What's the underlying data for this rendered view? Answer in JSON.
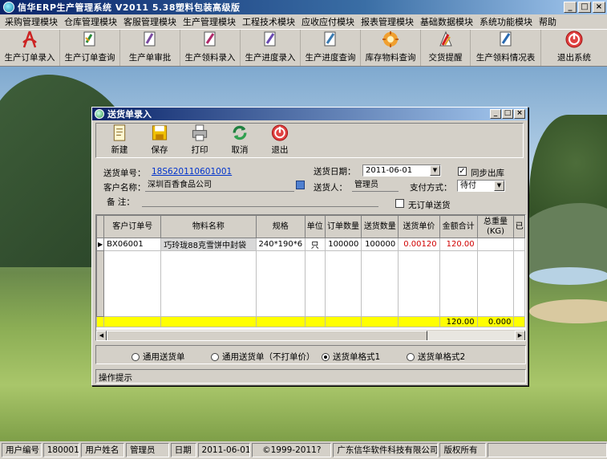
{
  "app": {
    "title": "信华ERP生产管理系统  V2011  5.38塑料包装高级版",
    "win_buttons": [
      "_",
      "□",
      "×"
    ]
  },
  "menu": [
    "采购管理模块",
    "仓库管理模块",
    "客服管理模块",
    "生产管理模块",
    "工程技术模块",
    "应收应付模块",
    "报表管理模块",
    "基础数据模块",
    "系统功能模块",
    "帮助"
  ],
  "toolbar": [
    {
      "label": "生产订单录入",
      "icon": "pdf-order-entry-icon",
      "color": "#cc2222"
    },
    {
      "label": "生产订单查询",
      "icon": "order-query-icon",
      "color": "#2a8a3a"
    },
    {
      "label": "生产单审批",
      "icon": "approval-icon",
      "color": "#7a4aa0"
    },
    {
      "label": "生产领料录入",
      "icon": "material-entry-icon",
      "color": "#b02a6a"
    },
    {
      "label": "生产进度录入",
      "icon": "progress-entry-icon",
      "color": "#6a4ab0"
    },
    {
      "label": "生产进度查询",
      "icon": "progress-query-icon",
      "color": "#3a7ab0"
    },
    {
      "label": "库存物料查询",
      "icon": "inventory-icon",
      "color": "#e08020"
    },
    {
      "label": "交货提醒",
      "icon": "delivery-alert-icon",
      "color": "#d02020"
    },
    {
      "label": "生产领料情况表",
      "icon": "material-report-icon",
      "color": "#2a6ab0"
    },
    {
      "label": "退出系统",
      "icon": "exit-icon",
      "color": "#d03030"
    }
  ],
  "child": {
    "title": "送货单录入",
    "toolbar": [
      {
        "label": "新建",
        "icon": "new-doc-icon"
      },
      {
        "label": "保存",
        "icon": "save-disk-icon"
      },
      {
        "label": "打印",
        "icon": "printer-icon"
      },
      {
        "label": "取消",
        "icon": "undo-arrows-icon"
      },
      {
        "label": "退出",
        "icon": "exit-icon"
      }
    ],
    "form": {
      "order_no_label": "送货单号：",
      "order_no": "18S620110601001",
      "date_label": "送货日期：",
      "date": "2011-06-01",
      "sync_label": "同步出库",
      "sync_checked": true,
      "customer_label": "客户名称：",
      "customer": "深圳百香食品公司",
      "deliverer_label": "送货人：",
      "deliverer": "管理员",
      "pay_label": "支付方式：",
      "pay": "待付",
      "note_label": "备    注：",
      "note": "",
      "no_order_label": "无订单送货",
      "no_order_checked": false
    },
    "grid": {
      "columns": [
        "客户订单号",
        "物料名称",
        "规格",
        "单位",
        "订单数量",
        "送货数量",
        "送货单价",
        "金额合计",
        "总重量(KG)",
        "已"
      ],
      "rows": [
        [
          "BX06001",
          "巧玲珑88克雪饼中封袋",
          "240*190*6",
          "只",
          "100000",
          "100000",
          "0.00120",
          "120.00",
          "",
          ""
        ]
      ],
      "totals": {
        "amount": "120.00",
        "weight": "0.000"
      }
    },
    "print_format": {
      "options": [
        "通用送货单",
        "通用送货单（不打单价）",
        "送货单格式1",
        "送货单格式2"
      ],
      "selected": "送货单格式1"
    },
    "hint": "操作提示"
  },
  "status": {
    "user_no_label": "用户编号",
    "user_no": "180001",
    "user_name_label": "用户姓名",
    "user_name": "管理员",
    "date_label": "日期",
    "date": "2011-06-01",
    "copyright": "©1999-2011?",
    "company": "广东信华软件科技有限公司",
    "rights": "版权所有"
  }
}
